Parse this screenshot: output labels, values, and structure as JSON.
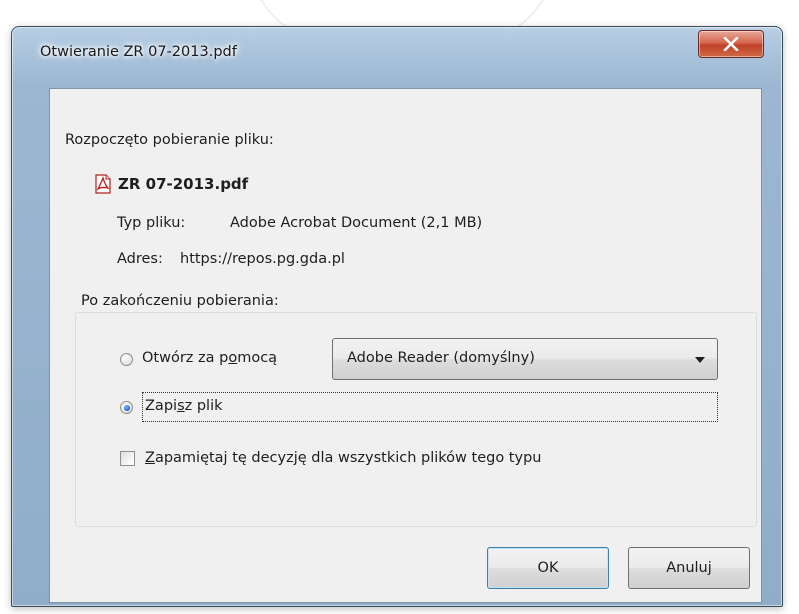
{
  "dialog": {
    "title": "Otwieranie ZR 07-2013.pdf",
    "close_icon": "close-x-icon"
  },
  "download": {
    "started_text": "Rozpoczęto pobieranie pliku:",
    "file_icon": "pdf-file-icon",
    "file_name": "ZR 07-2013.pdf",
    "type_label": "Typ pliku:",
    "type_value": "Adobe Acrobat Document (2,1 MB)",
    "address_label": "Adres:",
    "address_value": "https://repos.pg.gda.pl"
  },
  "after_download": {
    "group_label": "Po zakończeniu pobierania:",
    "open_with": {
      "label_before": "Otwórz za p",
      "label_accel": "o",
      "label_after": "mocą",
      "selected": false
    },
    "application_select": {
      "value": "Adobe Reader  (domyślny)"
    },
    "save_file": {
      "label_before": "Zapi",
      "label_accel": "s",
      "label_after": "z plik",
      "selected": true
    },
    "remember": {
      "label_accel": "Z",
      "label_after": "apamiętaj tę decyzję dla wszystkich plików tego typu",
      "checked": false
    }
  },
  "buttons": {
    "ok_label": "OK",
    "cancel_label": "Anuluj"
  },
  "colors": {
    "title_bar": "#a8c2db",
    "close_button": "#c1412a",
    "client_background": "#f0f0f0",
    "radio_selected": "#1c5fd6"
  }
}
